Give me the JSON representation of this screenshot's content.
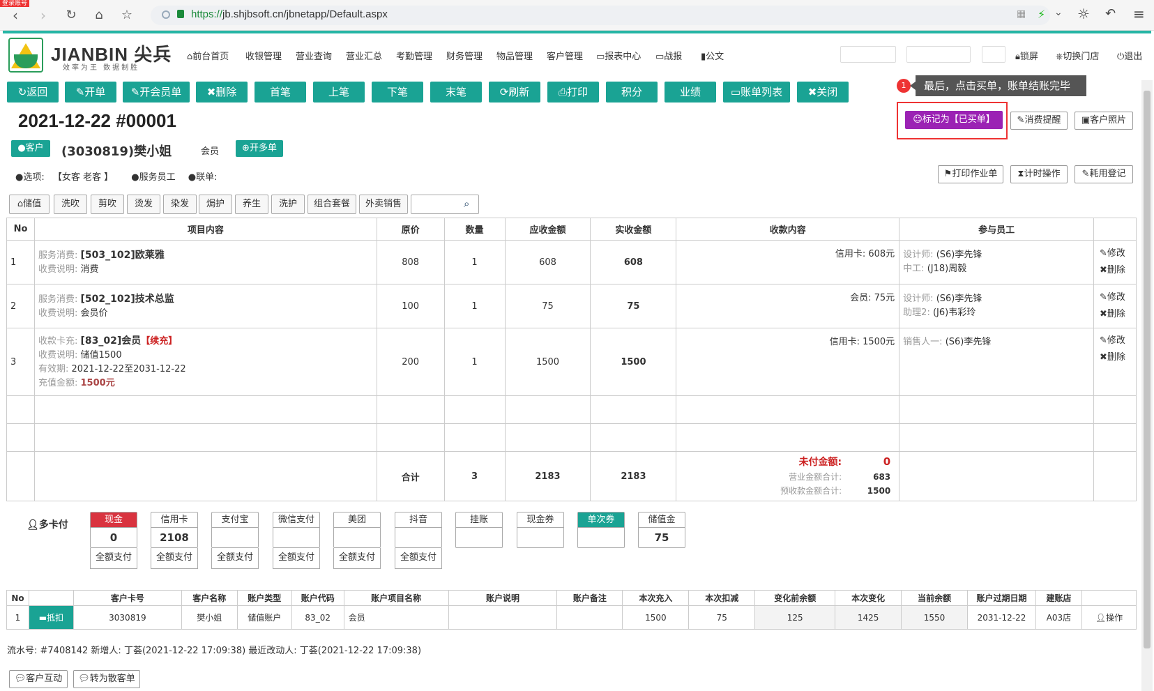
{
  "browser": {
    "login_tag": "登录账号",
    "url_https": "https://",
    "url_rest": "jb.shjbsoft.cn/jbnetapp/Default.aspx"
  },
  "header": {
    "brand": "JIANBIN 尖兵",
    "slogan": "效率为王 数据制胜",
    "menu": [
      "前台首页",
      "收银管理",
      "营业查询",
      "营业汇总",
      "考勤管理",
      "财务管理",
      "物品管理",
      "客户管理",
      "报表中心",
      "战报",
      "公文"
    ],
    "lock": "锁屏",
    "switch_store": "切换门店",
    "logout": "退出"
  },
  "toolbar": {
    "buttons": [
      "返回",
      "开单",
      "开会员单",
      "删除",
      "首笔",
      "上笔",
      "下笔",
      "末笔",
      "刷新",
      "打印",
      "积分",
      "业绩",
      "账单列表",
      "关闭"
    ]
  },
  "tooltip": {
    "badge": "1",
    "text": "最后，点击买单，账单结账完毕"
  },
  "bill": {
    "title": "2021-12-22  #00001",
    "mark_paid": "标记为【已买单】",
    "consume_reminder": "消费提醒",
    "customer_photo": "客户照片",
    "print_work": "打印作业单",
    "timer_op": "计时操作",
    "consumption_reg": "耗用登记"
  },
  "customer": {
    "btn_customer": "客户",
    "name": "(3030819)樊小姐",
    "type": "会员",
    "btn_multi": "开多单",
    "options_label": "选项:",
    "options_value": "【女客 老客 】",
    "service_staff": "服务员工",
    "linked_bill": "联单:"
  },
  "categories": [
    "储值",
    "洗吹",
    "剪吹",
    "烫发",
    "染发",
    "焗护",
    "养生",
    "洗护",
    "组合套餐",
    "外卖销售"
  ],
  "table": {
    "headers": [
      "No",
      "项目内容",
      "原价",
      "数量",
      "应收金额",
      "实收金额",
      "收款内容",
      "参与员工",
      ""
    ],
    "rows": [
      {
        "no": "1",
        "l1": "服务消费:",
        "v1": "[503_102]欧莱雅",
        "l2": "收费说明:",
        "v2": "消费",
        "l3": "",
        "v3": "",
        "l4": "",
        "v4": "",
        "price": "808",
        "qty": "1",
        "due": "608",
        "paid": "608",
        "pay": "信用卡:  608元",
        "s1l": "设计师:",
        "s1v": "(S6)李先锋",
        "s2l": "中工:",
        "s2v": "(J18)周毅"
      },
      {
        "no": "2",
        "l1": "服务消费:",
        "v1": "[502_102]技术总监",
        "l2": "收费说明:",
        "v2": "会员价",
        "l3": "",
        "v3": "",
        "l4": "",
        "v4": "",
        "price": "100",
        "qty": "1",
        "due": "75",
        "paid": "75",
        "pay": "会员:    75元",
        "s1l": "设计师:",
        "s1v": "(S6)李先锋",
        "s2l": "助理2:",
        "s2v": "(J6)韦彩玲"
      },
      {
        "no": "3",
        "l1": "收款卡充:",
        "v1": "[83_02]会员",
        "tag": "【续充】",
        "l2": "收费说明:",
        "v2": "储值1500",
        "l3": "有效期:",
        "v3": "2021-12-22至2031-12-22",
        "l4": "充值金额:",
        "v4": "1500元",
        "price": "200",
        "qty": "1",
        "due": "1500",
        "paid": "1500",
        "pay": "信用卡:  1500元",
        "s1l": "销售人一:",
        "s1v": "(S6)李先锋",
        "s2l": "",
        "s2v": ""
      }
    ],
    "edit": "修改",
    "delete": "删除",
    "total_label": "合计",
    "total_qty": "3",
    "total_due": "2183",
    "total_paid": "2183",
    "unpaid_label": "未付金额:",
    "unpaid_value": "0",
    "revenue_label": "营业金额合计:",
    "revenue_value": "683",
    "prepaid_label": "预收款金额合计:",
    "prepaid_value": "1500"
  },
  "payment": {
    "multi_card": "多卡付",
    "methods": [
      {
        "name": "现金",
        "value": "0",
        "full": "全额支付"
      },
      {
        "name": "信用卡",
        "value": "2108",
        "full": "全额支付"
      },
      {
        "name": "支付宝",
        "value": "",
        "full": "全额支付"
      },
      {
        "name": "微信支付",
        "value": "",
        "full": "全额支付"
      },
      {
        "name": "美团",
        "value": "",
        "full": "全额支付"
      },
      {
        "name": "抖音",
        "value": "",
        "full": "全额支付"
      },
      {
        "name": "挂账",
        "value": "",
        "full": ""
      },
      {
        "name": "现金券",
        "value": "",
        "full": ""
      },
      {
        "name": "单次券",
        "value": "",
        "full": ""
      },
      {
        "name": "储值金",
        "value": "75",
        "full": ""
      }
    ],
    "colors": {
      "cash_header": "#d9333f",
      "single_header": "#1aa394"
    }
  },
  "account": {
    "headers": [
      "No",
      "",
      "客户卡号",
      "客户名称",
      "账户类型",
      "账户代码",
      "账户项目名称",
      "账户说明",
      "账户备注",
      "本次充入",
      "本次扣减",
      "变化前余额",
      "本次变化",
      "当前余额",
      "账户过期日期",
      "建账店",
      ""
    ],
    "row": [
      "1",
      "抵扣",
      "3030819",
      "樊小姐",
      "储值账户",
      "83_02",
      "会员",
      "",
      "",
      "1500",
      "75",
      "125",
      "1425",
      "1550",
      "2031-12-22",
      "A03店",
      "操作"
    ]
  },
  "footer": {
    "info": "流水号: #7408142    新增人: 丁荟(2021-12-22 17:09:38)    最近改动人: 丁荟(2021-12-22 17:09:38)",
    "btn_interact": "客户互动",
    "btn_walkin": "转为散客单"
  }
}
